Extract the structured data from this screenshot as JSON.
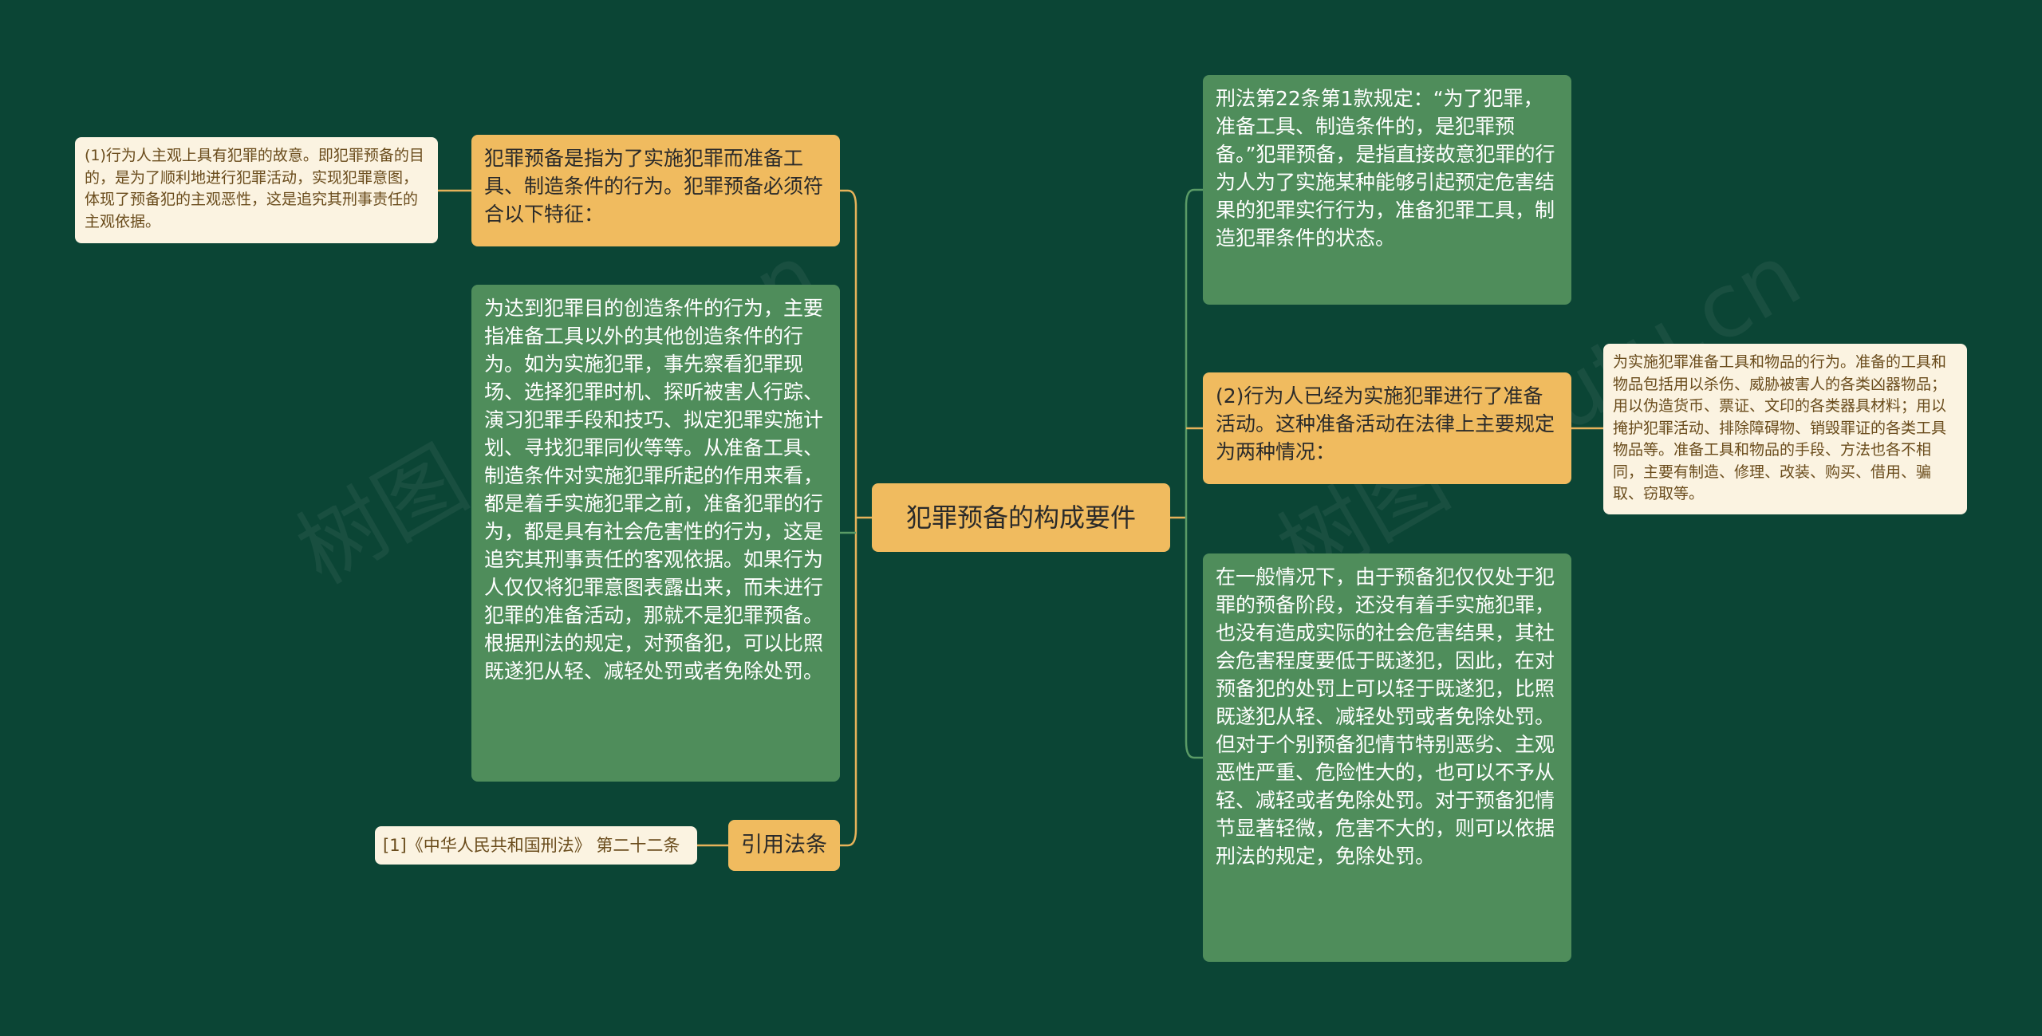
{
  "diagram": {
    "root": "犯罪预备的构成要件",
    "left": {
      "definition": "犯罪预备是指为了实施犯罪而准备工具、制造条件的行为。犯罪预备必须符合以下特征：",
      "definition_note": "(1)行为人主观上具有犯罪的故意。即犯罪预备的目的，是为了顺利地进行犯罪活动，实现犯罪意图，体现了预备犯的主观恶性，这是追究其刑事责任的主观依据。",
      "conditions": "为达到犯罪目的创造条件的行为，主要指准备工具以外的其他创造条件的行为。如为实施犯罪，事先察看犯罪现场、选择犯罪时机、探听被害人行踪、演习犯罪手段和技巧、拟定犯罪实施计划、寻找犯罪同伙等等。从准备工具、制造条件对实施犯罪所起的作用来看，都是着手实施犯罪之前，准备犯罪的行为，都是具有社会危害性的行为，这是追究其刑事责任的客观依据。如果行为人仅仅将犯罪意图表露出来，而未进行犯罪的准备活动，那就不是犯罪预备。根据刑法的规定，对预备犯，可以比照既遂犯从轻、减轻处罚或者免除处罚。",
      "citation_label": "引用法条",
      "citation_item": "[1]《中华人民共和国刑法》 第二十二条"
    },
    "right": {
      "article": "刑法第22条第1款规定：“为了犯罪，准备工具、制造条件的，是犯罪预备。”犯罪预备，是指直接故意犯罪的行为人为了实施某种能够引起预定危害结果的犯罪实行行为，准备犯罪工具，制造犯罪条件的状态。",
      "feature2": "(2)行为人已经为实施犯罪进行了准备活动。这种准备活动在法律上主要规定为两种情况：",
      "feature2_note": "为实施犯罪准备工具和物品的行为。准备的工具和物品包括用以杀伤、威胁被害人的各类凶器物品；用以伪造货币、票证、文印的各类器具材料；用以掩护犯罪活动、排除障碍物、销毁罪证的各类工具物品等。准备工具和物品的手段、方法也各不相同，主要有制造、修理、改装、购买、借用、骗取、窃取等。",
      "punishment": "在一般情况下，由于预备犯仅仅处于犯罪的预备阶段，还没有着手实施犯罪，也没有造成实际的社会危害结果，其社会危害程度要低于既遂犯，因此，在对预备犯的处罚上可以轻于既遂犯，比照既遂犯从轻、减轻处罚或者免除处罚。但对于个别预备犯情节特别恶劣、主观恶性严重、危险性大的，也可以不予从轻、减轻或者免除处罚。对于预备犯情节显著轻微，危害不大的，则可以依据刑法的规定，免除处罚。"
    }
  },
  "watermarks": [
    "树图 shutu.cn",
    "树图 shutu.cn"
  ],
  "colors": {
    "background": "#0b4535",
    "root_fill": "#f0bb5f",
    "green_node": "#4f8d5b",
    "cream_node": "#fbf3e1",
    "left_connector": "#e6b25a",
    "right_connector": "#5a9b66"
  }
}
